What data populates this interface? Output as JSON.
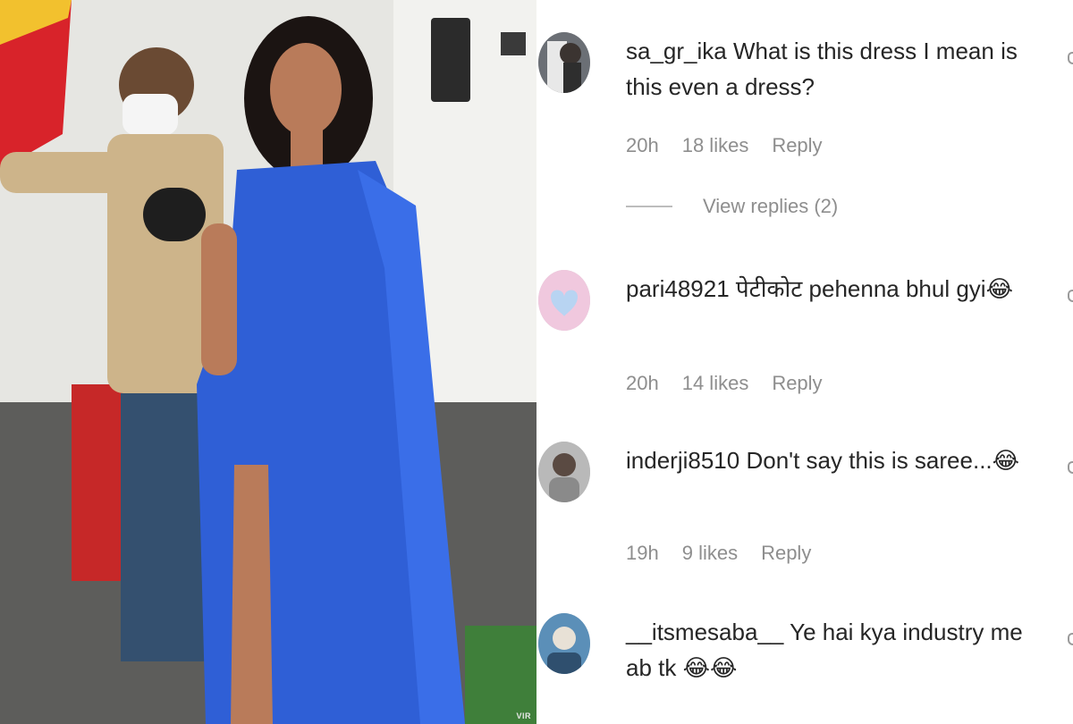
{
  "photo": {
    "alt_icon": "photo-scene",
    "watermark": "VIR"
  },
  "comments": [
    {
      "username": "sa_gr_ika",
      "text": "What is this dress I mean is this even a dress?",
      "time": "20h",
      "likes": "18 likes",
      "reply": "Reply",
      "avatar_color": "#6b6f75"
    },
    {
      "username": "pari48921",
      "text": "पेटीकोट pehenna bhul gyi😂",
      "time": "20h",
      "likes": "14 likes",
      "reply": "Reply",
      "avatar_color": "#e9b7d3"
    },
    {
      "username": "inderji8510",
      "text": "Don't say this is saree...😂",
      "time": "19h",
      "likes": "9 likes",
      "reply": "Reply",
      "avatar_color": "#9a9a9a"
    },
    {
      "username": "__itsmesaba__",
      "text": "Ye hai kya industry me ab tk 😂😂",
      "time": "",
      "likes": "",
      "reply": "",
      "avatar_color": "#5b8fb8"
    }
  ],
  "view_replies": "View replies (2)",
  "colors": {
    "text": "#262626",
    "meta": "#8e8e8e",
    "saree": "#2f5fd6"
  }
}
